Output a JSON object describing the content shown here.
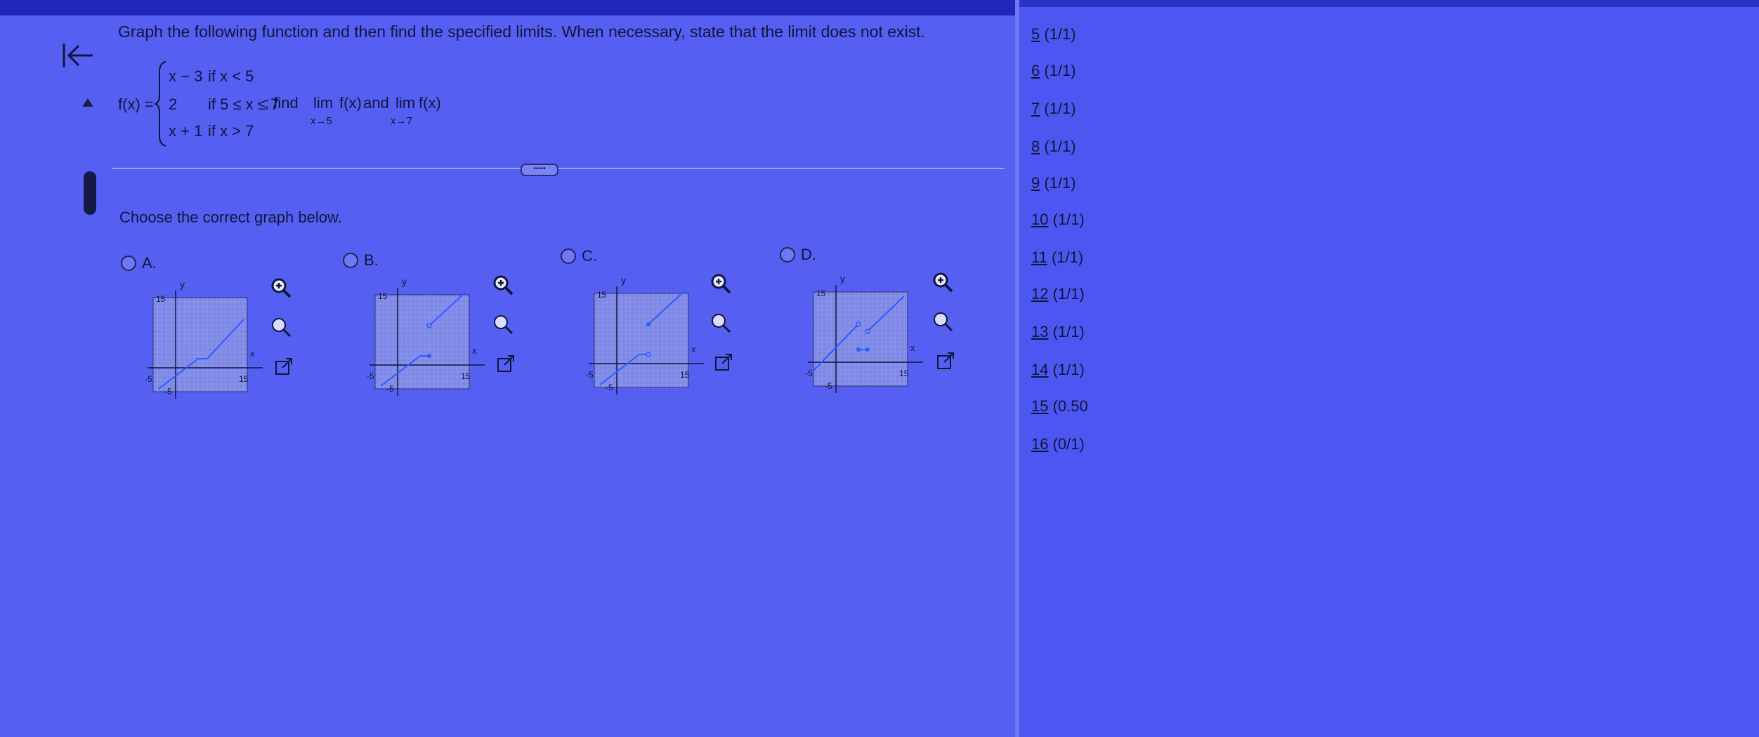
{
  "question": {
    "prompt": "Graph the following function and then find the specified limits. When necessary, state that the limit does not exist.",
    "fx_label": "f(x) =",
    "pieces": [
      {
        "expr": "x − 3",
        "cond": "if x < 5"
      },
      {
        "expr": "2",
        "cond": "if 5 ≤ x ≤ 7"
      },
      {
        "expr": "x + 1",
        "cond": "if x > 7"
      }
    ],
    "find_text": "; find",
    "lim1": "lim",
    "lim1_sub": "x→5",
    "lim1_fx": "f(x)",
    "and_text": "and",
    "lim2": "lim",
    "lim2_sub": "x→7",
    "lim2_fx": "f(x)"
  },
  "more_button": "•••••",
  "choose_text": "Choose the correct graph below.",
  "options": [
    {
      "label": "A.",
      "y_top": "15",
      "x_min": "-5",
      "x_max": "15",
      "y_min": "-5",
      "x_axis": "x",
      "y_axis": "y"
    },
    {
      "label": "B.",
      "y_top": "15",
      "x_min": "-5",
      "x_max": "15",
      "y_min": "-5",
      "x_axis": "x",
      "y_axis": "y"
    },
    {
      "label": "C.",
      "y_top": "15",
      "x_min": "-5",
      "x_max": "15",
      "y_min": "-5",
      "x_axis": "x",
      "y_axis": "y"
    },
    {
      "label": "D.",
      "y_top": "15",
      "x_min": "-5",
      "x_max": "15",
      "y_min": "-5",
      "x_axis": "x",
      "y_axis": "y"
    }
  ],
  "nav_items": [
    {
      "num": "5",
      "score": "(1/1)"
    },
    {
      "num": "6",
      "score": "(1/1)"
    },
    {
      "num": "7",
      "score": "(1/1)"
    },
    {
      "num": "8",
      "score": "(1/1)"
    },
    {
      "num": "9",
      "score": "(1/1)"
    },
    {
      "num": "10",
      "score": "(1/1)"
    },
    {
      "num": "11",
      "score": "(1/1)"
    },
    {
      "num": "12",
      "score": "(1/1)"
    },
    {
      "num": "13",
      "score": "(1/1)"
    },
    {
      "num": "14",
      "score": "(1/1)"
    },
    {
      "num": "15",
      "score": "(0.50"
    },
    {
      "num": "16",
      "score": "(0/1)"
    }
  ],
  "colors": {
    "accent_line": "#2b5cff",
    "grid": "#8a92d8",
    "text": "#10163a"
  }
}
